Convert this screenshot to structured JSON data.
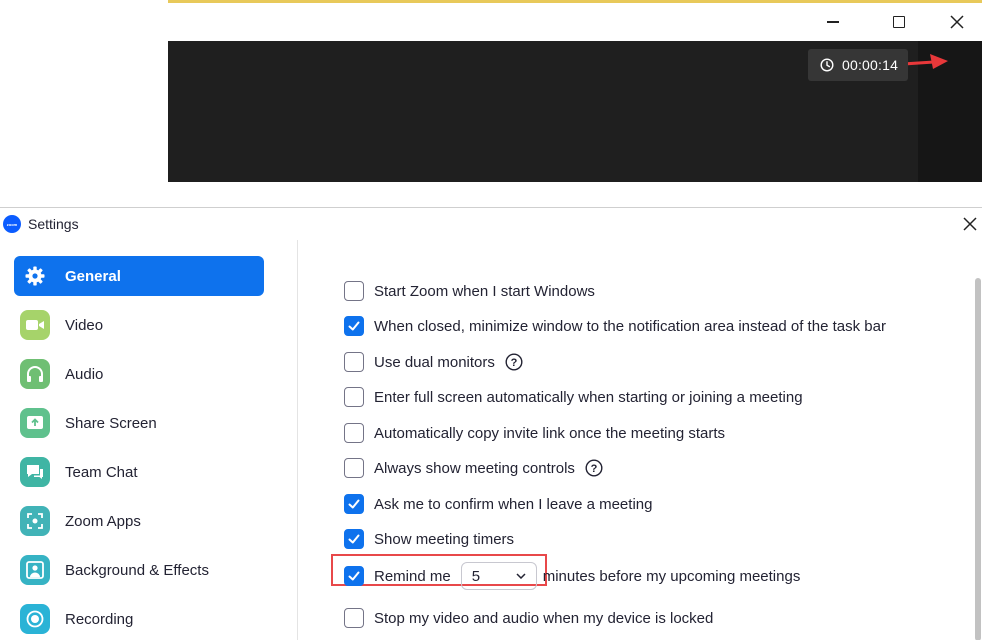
{
  "meeting": {
    "timer": "00:00:14",
    "annotation_color": "#e8383a"
  },
  "settings": {
    "title": "Settings",
    "accent_color": "#0e72ed",
    "sidebar": {
      "items": [
        {
          "label": "General",
          "icon": "gear-icon",
          "active": true
        },
        {
          "label": "Video",
          "icon": "video-camera-icon",
          "color": "#a6d36a"
        },
        {
          "label": "Audio",
          "icon": "headphones-icon",
          "color": "#6fbf73"
        },
        {
          "label": "Share Screen",
          "icon": "share-screen-icon",
          "color": "#5fc18d"
        },
        {
          "label": "Team Chat",
          "icon": "chat-icon",
          "color": "#3fb5a4"
        },
        {
          "label": "Zoom Apps",
          "icon": "apps-icon",
          "color": "#41b3b7"
        },
        {
          "label": "Background & Effects",
          "icon": "person-background-icon",
          "color": "#36b3c4"
        },
        {
          "label": "Recording",
          "icon": "recording-icon",
          "color": "#2ab3d6"
        }
      ]
    },
    "options": [
      {
        "label": "Start Zoom when I start Windows",
        "checked": false
      },
      {
        "label": "When closed, minimize window to the notification area instead of the task bar",
        "checked": true
      },
      {
        "label": "Use dual monitors",
        "checked": false,
        "help": true
      },
      {
        "label": "Enter full screen automatically when starting or joining a meeting",
        "checked": false
      },
      {
        "label": "Automatically copy invite link once the meeting starts",
        "checked": false
      },
      {
        "label": "Always show meeting controls",
        "checked": false,
        "help": true
      },
      {
        "label": "Ask me to confirm when I leave a meeting",
        "checked": true
      },
      {
        "label": "Show meeting timers",
        "checked": true,
        "highlighted": true
      },
      {
        "label": "Remind me",
        "checked": true,
        "select_value": "5",
        "after": "minutes before my upcoming meetings"
      },
      {
        "label": "Stop my video and audio when my device is locked",
        "checked": false
      }
    ]
  }
}
